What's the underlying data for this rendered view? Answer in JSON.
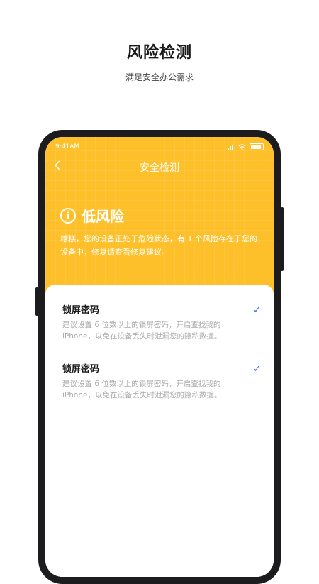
{
  "promo": {
    "title": "风险检测",
    "subtitle": "满足安全办公需求"
  },
  "status_bar": {
    "time": "9:41AM",
    "icons": [
      "signal-icon",
      "wifi-icon",
      "battery-icon"
    ]
  },
  "nav": {
    "back_icon": "chevron-left-icon",
    "title": "安全检测"
  },
  "risk": {
    "icon": "info-icon",
    "level": "低风险",
    "description": "糟糕，您的设备正处于危险状态，有 1 个风险存在于您的设备中，修复请查看修复建议。"
  },
  "items": [
    {
      "title": "锁屏密码",
      "description": "建议设置 6 位数以上的锁屏密码，开启查找我的iPhone，以免在设备丢失时泄漏您的隐私数据。",
      "check_icon": "check-icon"
    },
    {
      "title": "锁屏密码",
      "description": "建议设置 6 位数以上的锁屏密码，开启查找我的iPhone，以免在设备丢失时泄漏您的隐私数据。",
      "check_icon": "check-icon"
    }
  ],
  "colors": {
    "header_yellow": "#fdc02b",
    "check_blue": "#3b6ee9",
    "phone_frame": "#1c1c1e"
  }
}
